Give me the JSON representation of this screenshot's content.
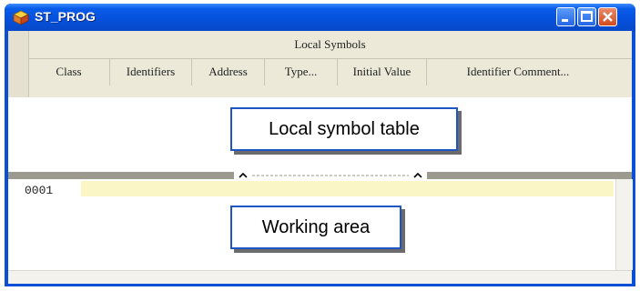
{
  "window": {
    "title": "ST_PROG"
  },
  "symbols": {
    "title": "Local Symbols",
    "columns": [
      "Class",
      "Identifiers",
      "Address",
      "Type...",
      "Initial Value",
      "Identifier Comment..."
    ]
  },
  "editor": {
    "line_number": "0001"
  },
  "callouts": {
    "symbol_table": "Local symbol table",
    "working_area": "Working area"
  },
  "icons": {
    "app": "plc-program-icon",
    "minimize": "minimize-icon",
    "maximize": "maximize-icon",
    "close": "close-icon"
  },
  "colors": {
    "titlebar": "#0550dc",
    "callout_border": "#1f56c6",
    "line_highlight": "#fbf6c5"
  }
}
